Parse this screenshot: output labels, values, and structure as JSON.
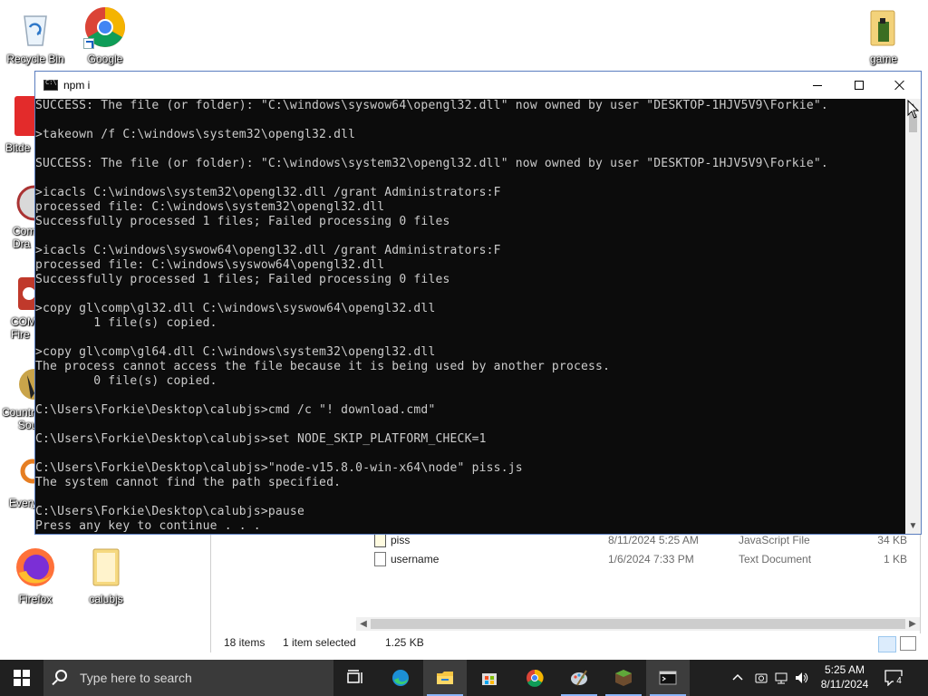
{
  "desktop": {
    "icons": [
      {
        "label": "Recycle Bin",
        "icon": "recycle-bin-icon"
      },
      {
        "label": "Google",
        "icon": "chrome-icon"
      },
      {
        "label": "game",
        "icon": "folder-icon"
      },
      {
        "label": "Bitde",
        "icon": "bitdefender-icon"
      },
      {
        "label": "Com",
        "label2": "Dra",
        "icon": "app-icon"
      },
      {
        "label": "COM",
        "label2": "Fire",
        "icon": "app-icon"
      },
      {
        "label": "Countr",
        "label2": "Sou",
        "icon": "game-icon"
      },
      {
        "label": "Every",
        "icon": "search-app-icon"
      },
      {
        "label": "Firefox",
        "icon": "firefox-icon"
      },
      {
        "label": "calubjs",
        "icon": "folder-icon"
      }
    ]
  },
  "console": {
    "title": "npm i",
    "lines": [
      "SUCCESS: The file (or folder): \"C:\\windows\\syswow64\\opengl32.dll\" now owned by user \"DESKTOP-1HJV5V9\\Forkie\".",
      "",
      ">takeown /f C:\\windows\\system32\\opengl32.dll",
      "",
      "SUCCESS: The file (or folder): \"C:\\windows\\system32\\opengl32.dll\" now owned by user \"DESKTOP-1HJV5V9\\Forkie\".",
      "",
      ">icacls C:\\windows\\system32\\opengl32.dll /grant Administrators:F",
      "processed file: C:\\windows\\system32\\opengl32.dll",
      "Successfully processed 1 files; Failed processing 0 files",
      "",
      ">icacls C:\\windows\\syswow64\\opengl32.dll /grant Administrators:F",
      "processed file: C:\\windows\\syswow64\\opengl32.dll",
      "Successfully processed 1 files; Failed processing 0 files",
      "",
      ">copy gl\\comp\\gl32.dll C:\\windows\\syswow64\\opengl32.dll",
      "        1 file(s) copied.",
      "",
      ">copy gl\\comp\\gl64.dll C:\\windows\\system32\\opengl32.dll",
      "The process cannot access the file because it is being used by another process.",
      "        0 file(s) copied.",
      "",
      "C:\\Users\\Forkie\\Desktop\\calubjs>cmd /c \"! download.cmd\"",
      "",
      "C:\\Users\\Forkie\\Desktop\\calubjs>set NODE_SKIP_PLATFORM_CHECK=1",
      "",
      "C:\\Users\\Forkie\\Desktop\\calubjs>\"node-v15.8.0-win-x64\\node\" piss.js",
      "The system cannot find the path specified.",
      "",
      "C:\\Users\\Forkie\\Desktop\\calubjs>pause",
      "Press any key to continue . . ."
    ]
  },
  "explorer": {
    "files": [
      {
        "name": "piss",
        "date": "8/11/2024 5:25 AM",
        "type": "JavaScript File",
        "size": "34 KB"
      },
      {
        "name": "username",
        "date": "1/6/2024 7:33 PM",
        "type": "Text Document",
        "size": "1 KB"
      }
    ],
    "status": {
      "items": "18 items",
      "selected": "1 item selected",
      "size": "1.25 KB"
    }
  },
  "taskbar": {
    "search_placeholder": "Type here to search",
    "apps": [
      "task-view-icon",
      "edge-icon",
      "file-explorer-icon",
      "store-icon",
      "chrome-icon",
      "paint-icon",
      "minecraft-icon",
      "terminal-icon"
    ],
    "time": "5:25 AM",
    "date": "8/11/2024",
    "notification_count": "4"
  }
}
